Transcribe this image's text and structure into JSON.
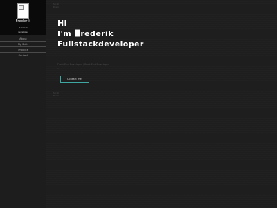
{
  "sidebar": {
    "brand_name": "Frederik",
    "brand_sub_1": "Fullstack",
    "brand_sub_2": "developer",
    "nav": [
      "About",
      "My Skills",
      "Projects",
      "Contact"
    ]
  },
  "faint_top": [
    "Scroll",
    "Down"
  ],
  "faint_mid": [
    "Scroll",
    "Down"
  ],
  "hero": {
    "line1": "Hi",
    "line2_prefix": "I'm ",
    "line2_rest": "rederik",
    "line3": "Fullstackdeveloper"
  },
  "roles": "Front End Developer / Back End Developer",
  "roles_dot": "o",
  "contact_label": "Contact me!",
  "colors": {
    "background": "#1e1e1e",
    "sidebar_head": "#0a0a0a",
    "accent": "#3fa7a1",
    "text": "#ffffff"
  }
}
